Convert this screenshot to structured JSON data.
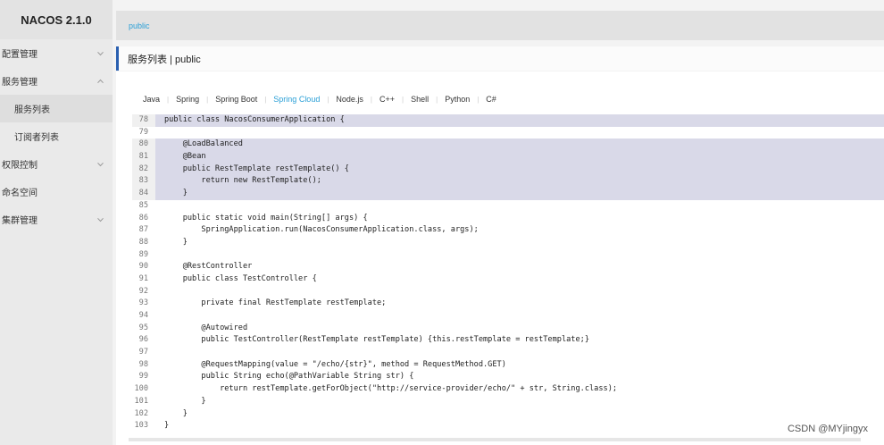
{
  "app": {
    "brand": "NACOS 2.1.0"
  },
  "sidebar": {
    "items": [
      {
        "label": "配置管理",
        "expanded": false
      },
      {
        "label": "服务管理",
        "expanded": true
      },
      {
        "label": "服务列表",
        "sub": true,
        "active": true
      },
      {
        "label": "订阅者列表",
        "sub": true,
        "active": false
      },
      {
        "label": "权限控制",
        "expanded": false
      },
      {
        "label": "命名空间"
      },
      {
        "label": "集群管理",
        "expanded": false
      }
    ]
  },
  "topbar": {
    "namespace": "public"
  },
  "page": {
    "title": "服务列表  |  public"
  },
  "tabs": [
    "Java",
    "Spring",
    "Spring Boot",
    "Spring Cloud",
    "Node.js",
    "C++",
    "Shell",
    "Python",
    "C#"
  ],
  "active_tab": "Spring Cloud",
  "code": {
    "lines": [
      {
        "n": "78",
        "t": "public class NacosConsumerApplication {"
      },
      {
        "n": "79",
        "t": ""
      },
      {
        "n": "80",
        "t": "    @LoadBalanced"
      },
      {
        "n": "81",
        "t": "    @Bean"
      },
      {
        "n": "82",
        "t": "    public RestTemplate restTemplate() {"
      },
      {
        "n": "83",
        "t": "        return new RestTemplate();"
      },
      {
        "n": "84",
        "t": "    }"
      },
      {
        "n": "85",
        "t": ""
      },
      {
        "n": "86",
        "t": "    public static void main(String[] args) {"
      },
      {
        "n": "87",
        "t": "        SpringApplication.run(NacosConsumerApplication.class, args);"
      },
      {
        "n": "88",
        "t": "    }"
      },
      {
        "n": "89",
        "t": ""
      },
      {
        "n": "90",
        "t": "    @RestController"
      },
      {
        "n": "91",
        "t": "    public class TestController {"
      },
      {
        "n": "92",
        "t": ""
      },
      {
        "n": "93",
        "t": "        private final RestTemplate restTemplate;"
      },
      {
        "n": "94",
        "t": ""
      },
      {
        "n": "95",
        "t": "        @Autowired"
      },
      {
        "n": "96",
        "t": "        public TestController(RestTemplate restTemplate) {this.restTemplate = restTemplate;}"
      },
      {
        "n": "97",
        "t": ""
      },
      {
        "n": "98",
        "t": "        @RequestMapping(value = \"/echo/{str}\", method = RequestMethod.GET)"
      },
      {
        "n": "99",
        "t": "        public String echo(@PathVariable String str) {"
      },
      {
        "n": "100",
        "t": "            return restTemplate.getForObject(\"http://service-provider/echo/\" + str, String.class);"
      },
      {
        "n": "101",
        "t": "        }"
      },
      {
        "n": "102",
        "t": "    }"
      },
      {
        "n": "103",
        "t": "}"
      }
    ],
    "highlighted": [
      "78",
      "80",
      "81",
      "82",
      "83",
      "84"
    ]
  },
  "watermark": "CSDN @MYjingyx",
  "colors": {
    "accent": "#2a9fd6",
    "highlight": "#d9d9e8",
    "header_bar": "#2a5fb0"
  }
}
